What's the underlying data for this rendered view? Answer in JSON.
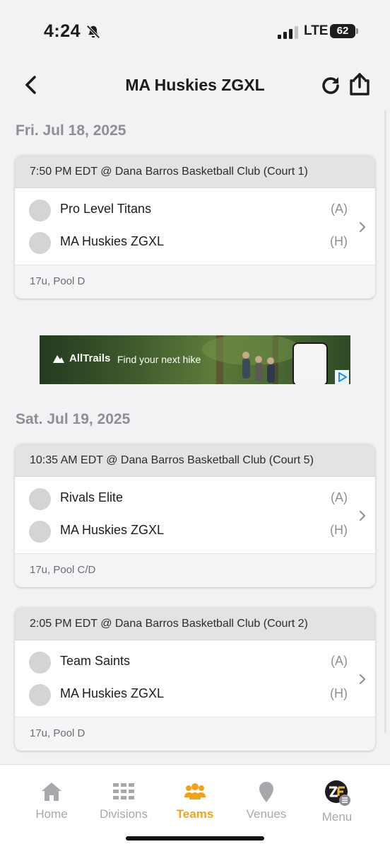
{
  "status_bar": {
    "time": "4:24",
    "network": "LTE",
    "battery": "62"
  },
  "nav": {
    "title": "MA Huskies ZGXL"
  },
  "days": [
    {
      "date": "Fri. Jul 18, 2025",
      "games": [
        {
          "header": "7:50 PM EDT @ Dana Barros Basketball Club (Court 1)",
          "away": {
            "name": "Pro Level Titans",
            "side": "(A)"
          },
          "home": {
            "name": "MA Huskies ZGXL",
            "side": "(H)"
          },
          "footer": "17u, Pool D"
        }
      ]
    },
    {
      "date": "Sat. Jul 19, 2025",
      "games": [
        {
          "header": "10:35 AM EDT @ Dana Barros Basketball Club (Court 5)",
          "away": {
            "name": "Rivals Elite",
            "side": "(A)"
          },
          "home": {
            "name": "MA Huskies ZGXL",
            "side": "(H)"
          },
          "footer": "17u, Pool C/D"
        },
        {
          "header": "2:05 PM EDT @ Dana Barros Basketball Club (Court 2)",
          "away": {
            "name": "Team Saints",
            "side": "(A)"
          },
          "home": {
            "name": "MA Huskies ZGXL",
            "side": "(H)"
          },
          "footer": "17u, Pool D"
        }
      ]
    }
  ],
  "ad": {
    "brand": "AllTrails",
    "tagline": "Find your next hike"
  },
  "tabs": [
    {
      "label": "Home",
      "icon": "home-icon",
      "active": false
    },
    {
      "label": "Divisions",
      "icon": "divisions-icon",
      "active": false
    },
    {
      "label": "Teams",
      "icon": "teams-icon",
      "active": true
    },
    {
      "label": "Venues",
      "icon": "venues-icon",
      "active": false
    },
    {
      "label": "Menu",
      "icon": "menu-icon",
      "active": false
    }
  ],
  "colors": {
    "accent": "#f2a21a",
    "inactive": "#a8a8ac",
    "card_header": "#e3e3e3"
  }
}
